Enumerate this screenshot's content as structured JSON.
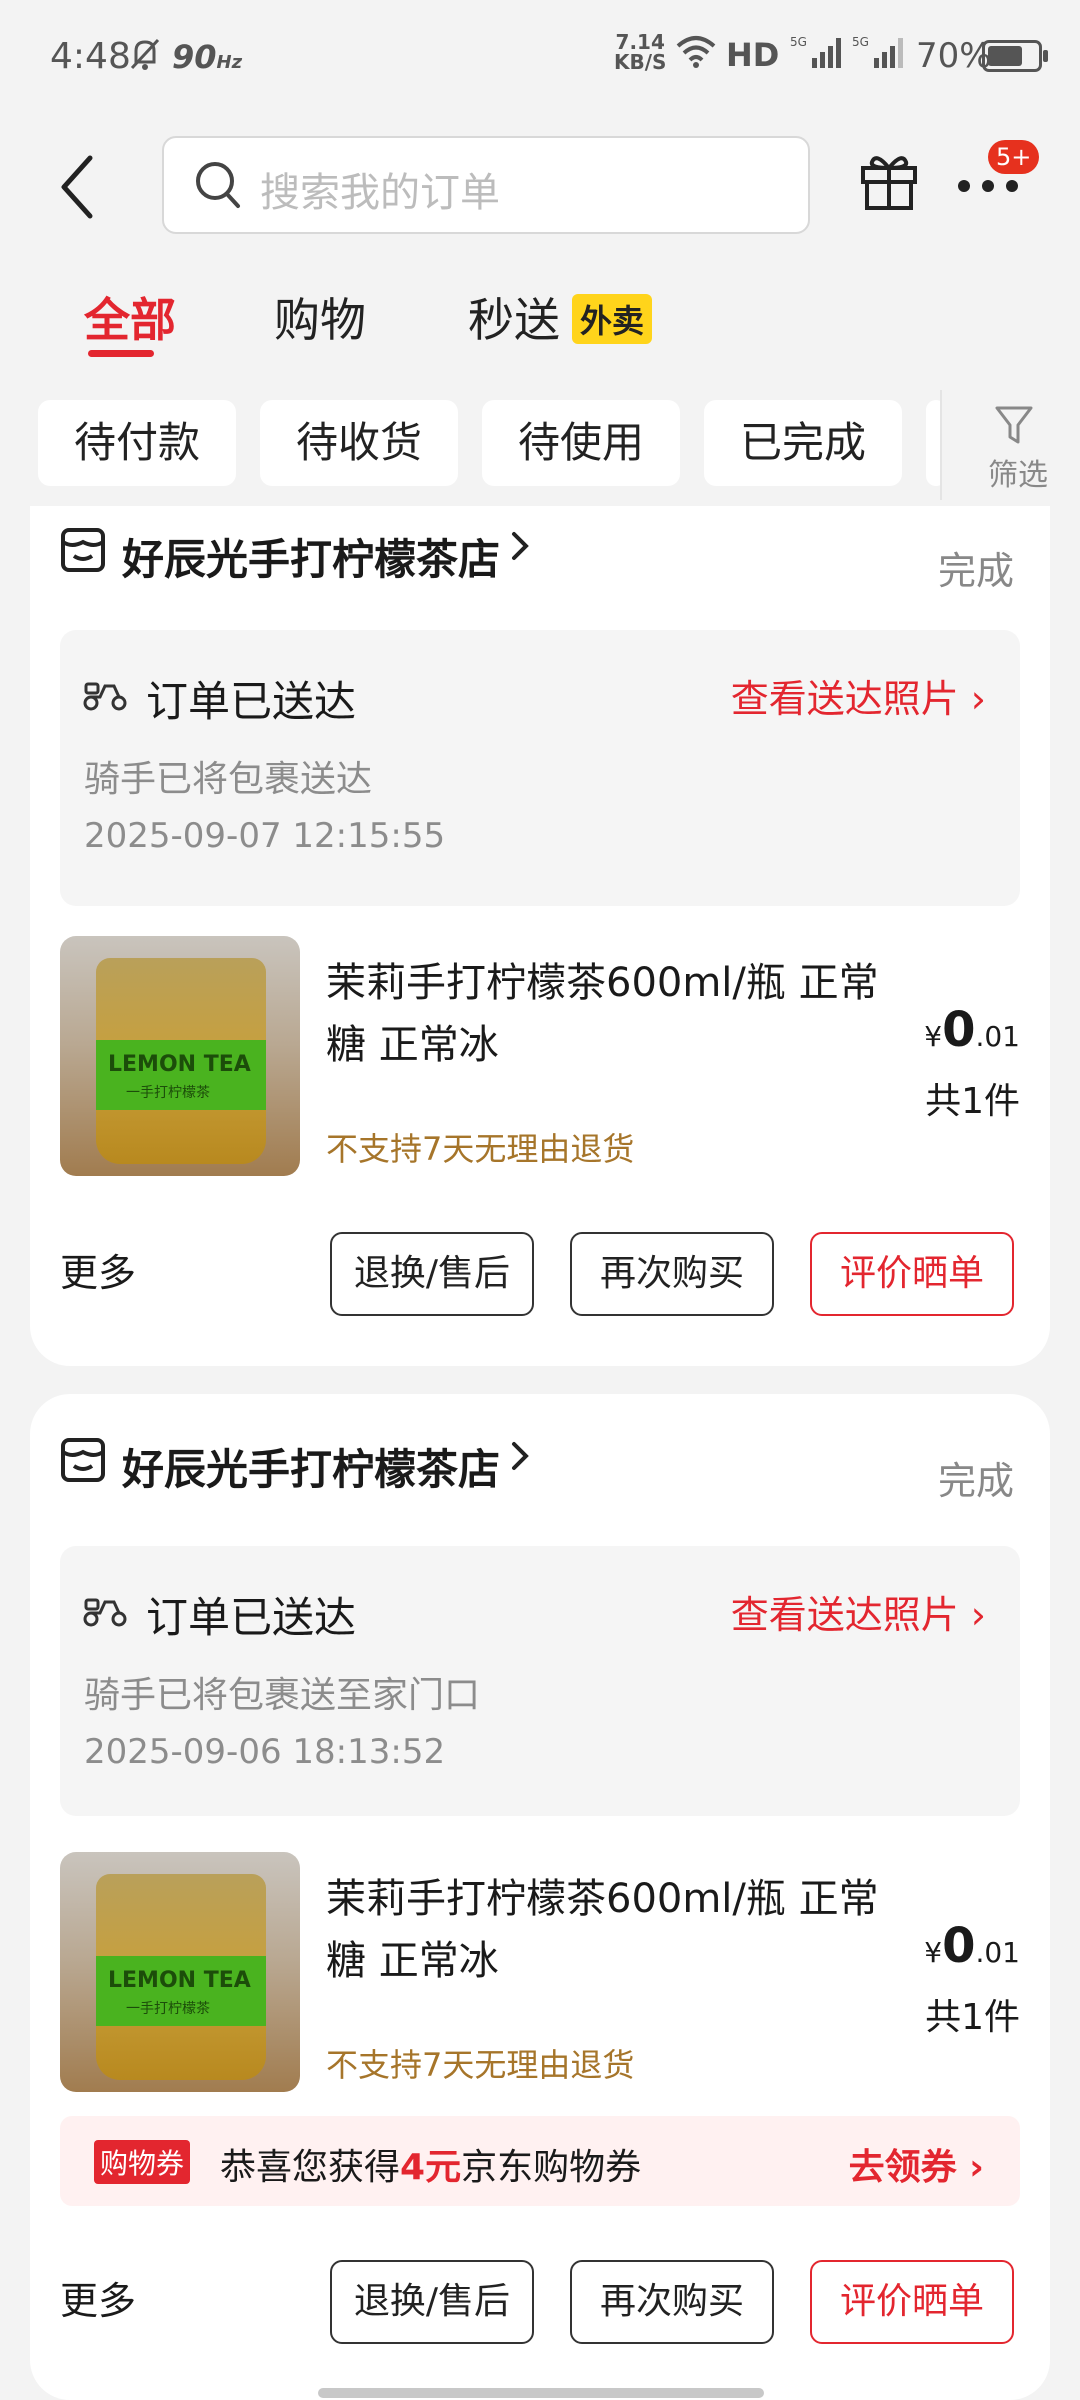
{
  "status_bar": {
    "time": "4:48",
    "refresh_rate": "90",
    "refresh_unit": "Hz",
    "net_speed_value": "7.14",
    "net_speed_unit": "KB/S",
    "hd": "HD",
    "battery": "70%"
  },
  "header": {
    "search_placeholder": "搜索我的订单",
    "badge": "5+"
  },
  "tabs": [
    {
      "label": "全部",
      "active": true
    },
    {
      "label": "购物",
      "active": false
    },
    {
      "label": "秒送",
      "active": false,
      "tag": "外卖"
    }
  ],
  "filters": {
    "chips": [
      "待付款",
      "待收货",
      "待使用",
      "已完成"
    ],
    "filter_label": "筛选"
  },
  "orders": [
    {
      "shop": "好辰光手打柠檬茶店",
      "status": "完成",
      "delivery_title": "订单已送达",
      "delivery_link": "查看送达照片",
      "delivery_desc": "骑手已将包裹送达",
      "delivery_time": "2025-09-07 12:15:55",
      "product_title": "茉莉手打柠檬茶600ml/瓶 正常糖 正常冰",
      "product_note": "不支持7天无理由退货",
      "price_symbol": "¥",
      "price_int": "0",
      "price_dec": ".01",
      "qty": "共1件",
      "more": "更多",
      "btn_refund": "退换/售后",
      "btn_rebuy": "再次购买",
      "btn_review": "评价晒单",
      "thumb_text": "LEMON TEA",
      "thumb_sub": "一手打柠檬茶"
    },
    {
      "shop": "好辰光手打柠檬茶店",
      "status": "完成",
      "delivery_title": "订单已送达",
      "delivery_link": "查看送达照片",
      "delivery_desc": "骑手已将包裹送至家门口",
      "delivery_time": "2025-09-06 18:13:52",
      "product_title": "茉莉手打柠檬茶600ml/瓶 正常糖 正常冰",
      "product_note": "不支持7天无理由退货",
      "price_symbol": "¥",
      "price_int": "0",
      "price_dec": ".01",
      "qty": "共1件",
      "coupon_tag": "购物券",
      "coupon_prefix": "恭喜您获得",
      "coupon_amount": "4元",
      "coupon_suffix": "京东购物券",
      "coupon_link": "去领券",
      "more": "更多",
      "btn_refund": "退换/售后",
      "btn_rebuy": "再次购买",
      "btn_review": "评价晒单",
      "thumb_text": "LEMON TEA",
      "thumb_sub": "一手打柠檬茶"
    }
  ],
  "colors": {
    "accent": "#e3262f",
    "note": "#a6752a",
    "tag_yellow": "#ffd41b"
  }
}
